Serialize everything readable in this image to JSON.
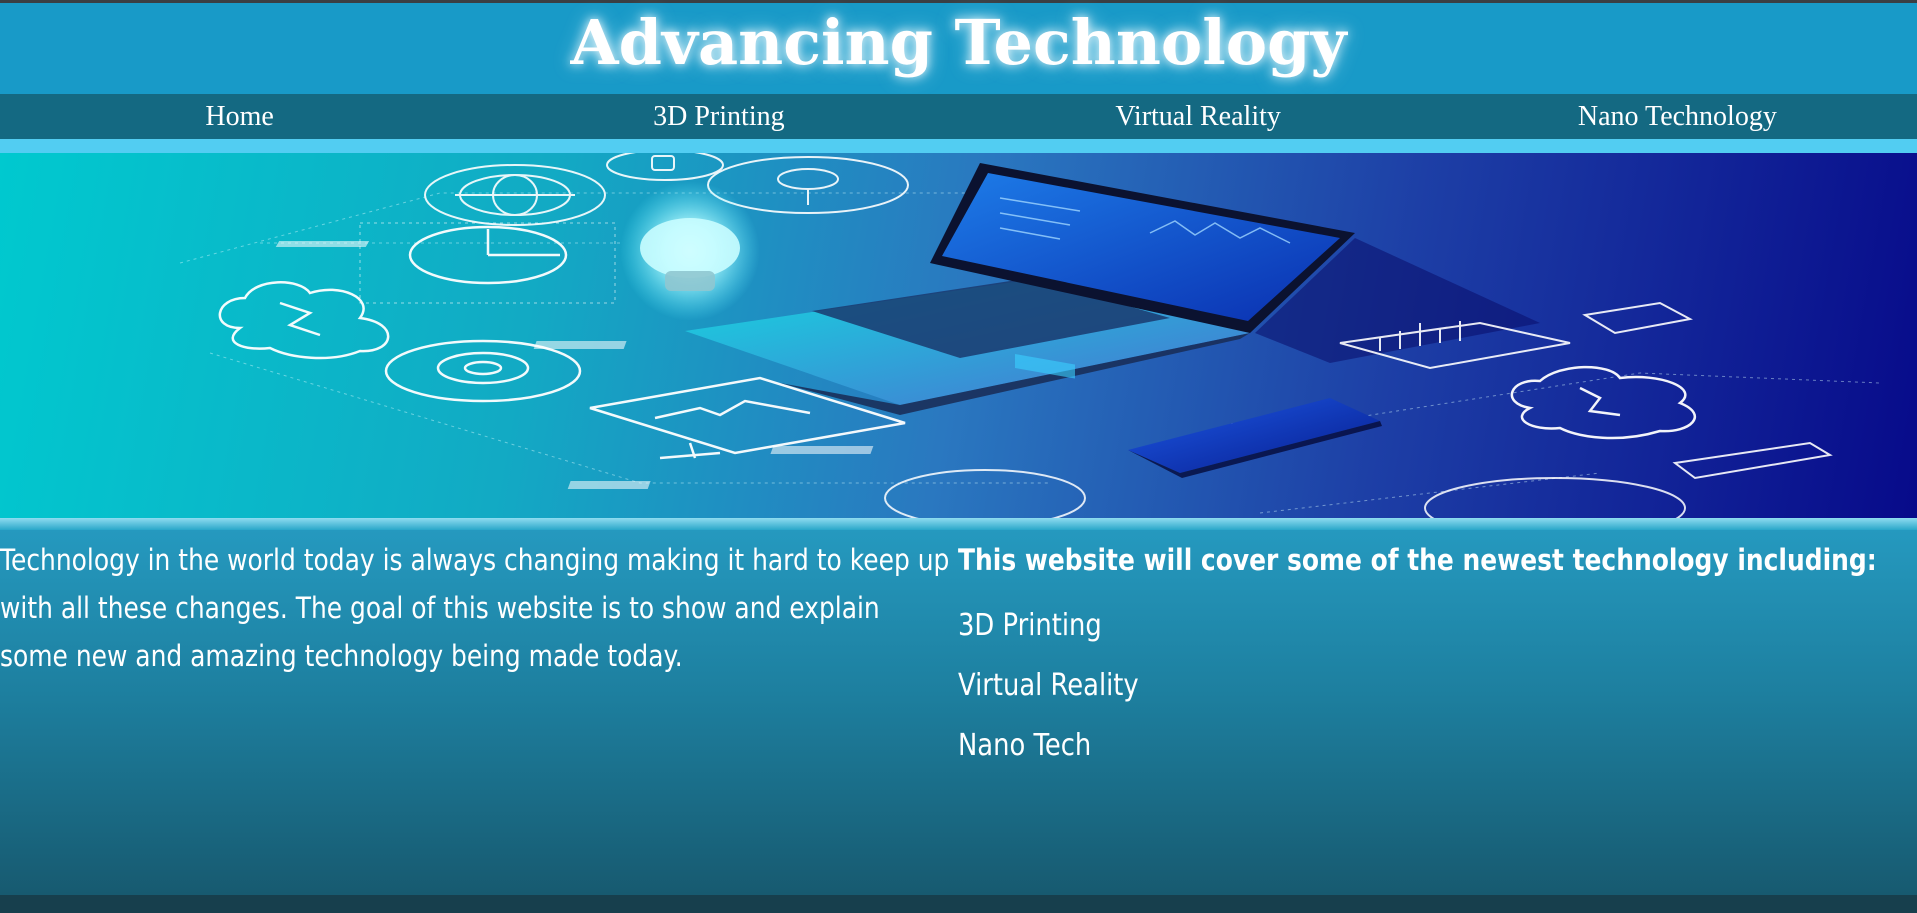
{
  "header": {
    "title": "Advancing Technology"
  },
  "nav": {
    "items": [
      {
        "label": "Home"
      },
      {
        "label": "3D Printing"
      },
      {
        "label": "Virtual Reality"
      },
      {
        "label": "Nano Technology"
      }
    ]
  },
  "hero": {
    "icons": [
      "globe-icon",
      "lock-icon",
      "search-icon",
      "pie-chart-icon",
      "cloud-icon",
      "gear-icon",
      "lightbulb-icon",
      "monitor-chart-icon",
      "laptop-icon",
      "smartphone-icon",
      "bar-chart-icon",
      "card-icon"
    ]
  },
  "intro": {
    "text": "Technology in the world today is always changing making it hard to keep up with all these changes. The goal of this website is to show and explain some new and amazing technology being made today."
  },
  "coverage": {
    "heading": "This website will cover some of the newest technology including:",
    "items": [
      {
        "label": "3D Printing"
      },
      {
        "label": "Virtual Reality"
      },
      {
        "label": "Nano Tech"
      }
    ]
  },
  "colors": {
    "title_bar": "#189ac8",
    "nav_bar": "#146982",
    "accent": "#52cdf2",
    "content_top": "#2599bf",
    "content_bottom": "#175a70"
  }
}
